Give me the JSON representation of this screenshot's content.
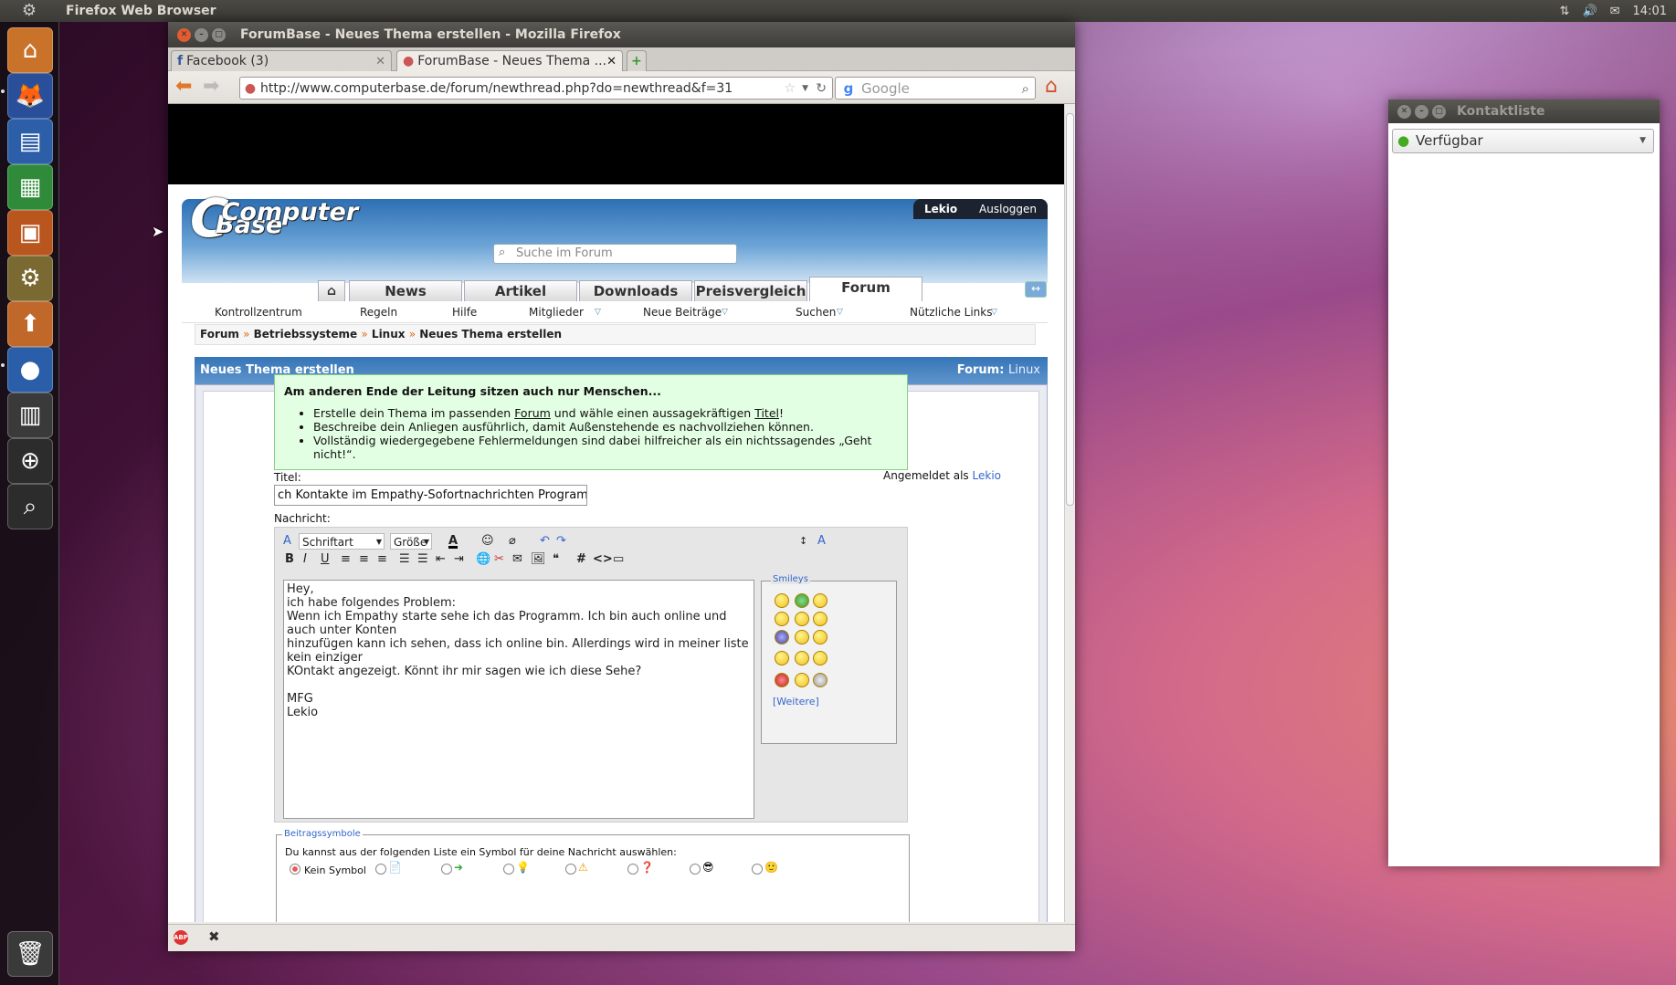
{
  "topbar": {
    "title": "Firefox Web Browser",
    "time": "14:01"
  },
  "window": {
    "title": "ForumBase - Neues Thema erstellen - Mozilla Firefox"
  },
  "tabs": [
    {
      "label": "Facebook (3)"
    },
    {
      "label": "ForumBase - Neues Thema ..."
    }
  ],
  "navbar": {
    "url": "http://www.computerbase.de/forum/newthread.php?do=newthread&f=31",
    "search_placeholder": "Google"
  },
  "site": {
    "logo_top": "Computer",
    "logo_bottom": "Base",
    "search_placeholder": "Suche im Forum",
    "user": "Lekio",
    "logout": "Ausloggen",
    "nav": [
      "News",
      "Artikel",
      "Downloads",
      "Preisvergleich",
      "Forum"
    ],
    "subnav": [
      "Kontrollzentrum",
      "Regeln",
      "Hilfe",
      "Mitglieder",
      "Neue Beiträge",
      "Suchen",
      "Nützliche Links"
    ],
    "breadcrumb": [
      "Forum",
      "Betriebssysteme",
      "Linux",
      "Neues Thema erstellen"
    ],
    "breadcrumb_sep": "»"
  },
  "panel": {
    "title": "Neues Thema erstellen",
    "forum_label": "Forum",
    "forum_sep": ":",
    "forum_name": "Linux"
  },
  "tips": {
    "heading": "Am anderen Ende der Leitung sitzen auch nur Menschen...",
    "l1a": "Erstelle dein Thema im passenden ",
    "l1b": "Forum",
    "l1c": " und wähle einen aussagekräftigen ",
    "l1d": "Titel",
    "l1e": "!",
    "l2": "Beschreibe dein Anliegen ausführlich, damit Außenstehende es nachvollziehen können.",
    "l3": "Vollständig wiedergegebene Fehlermeldungen sind dabei hilfreicher als ein nichtssagendes „Geht nicht!“."
  },
  "form": {
    "title_label": "Titel:",
    "title_value": "ch Kontakte im Empathy-Sofortnachrichten Programm?",
    "logged_as": "Angemeldet als",
    "user": "Lekio",
    "message_label": "Nachricht:",
    "font_select": "Schriftart",
    "size_select": "Größe",
    "message": "Hey,\nich habe folgendes Problem:\nWenn ich Empathy starte sehe ich das Programm. Ich bin auch online und auch unter Konten\nhinzufügen kann ich sehen, dass ich online bin. Allerdings wird in meiner liste kein einziger\nKOntakt angezeigt. Könnt ihr mir sagen wie ich diese Sehe?\n\nMFG\nLekio",
    "smileys_legend": "Smileys",
    "more_smileys": "[Weitere]",
    "symbols_legend": "Beitragssymbole",
    "symbols_desc": "Du kannst aus der folgenden Liste ein Symbol für deine Nachricht auswählen:",
    "no_symbol": "Kein Symbol"
  },
  "contacts": {
    "title": "Kontaktliste",
    "status": "Verfügbar"
  }
}
